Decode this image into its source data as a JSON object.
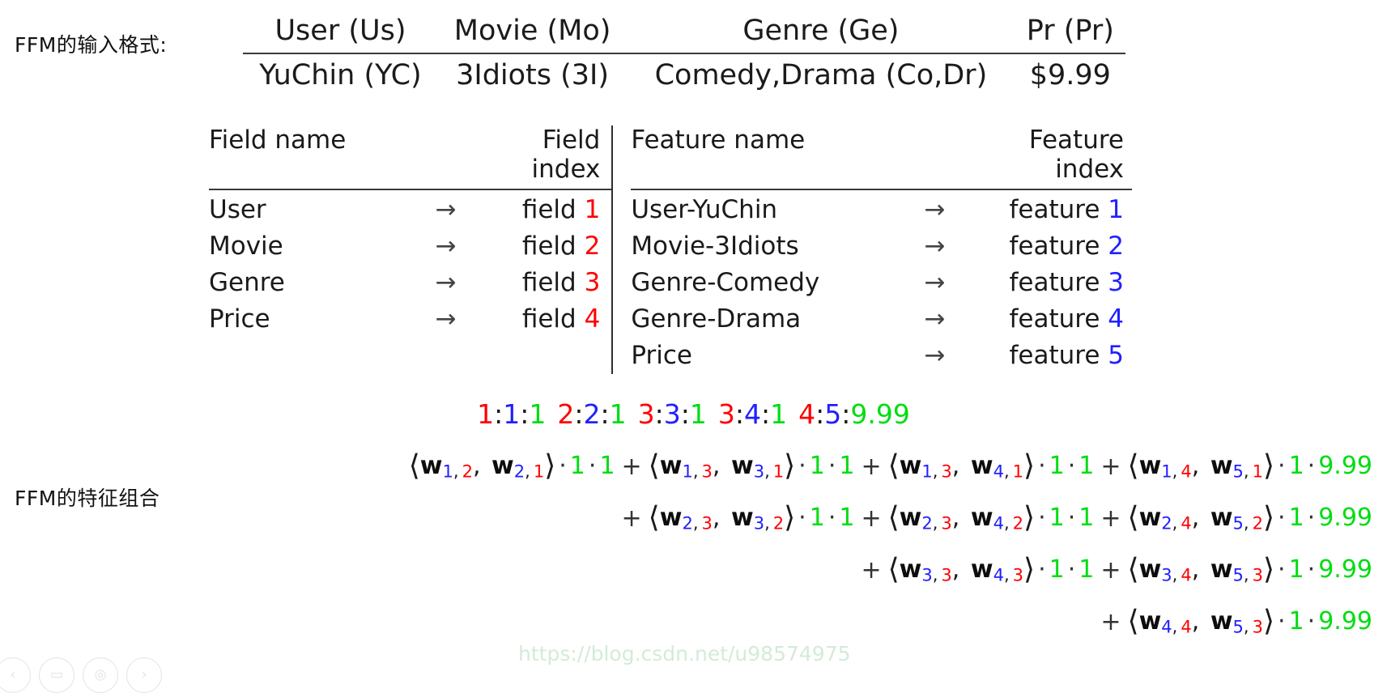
{
  "labels": {
    "input_format": "FFM的输入格式:",
    "feature_combination": "FFM的特征组合"
  },
  "input_format_table": {
    "headers": [
      "User (Us)",
      "Movie (Mo)",
      "Genre (Ge)",
      "Pr (Pr)"
    ],
    "row": [
      "YuChin (YC)",
      "3Idiots (3I)",
      "Comedy,Drama (Co,Dr)",
      "$9.99"
    ]
  },
  "mapping": {
    "field": {
      "header_name": "Field name",
      "header_index": "Field index",
      "arrow": "→",
      "index_prefix": "field",
      "rows": [
        {
          "name": "User",
          "index": "1"
        },
        {
          "name": "Movie",
          "index": "2"
        },
        {
          "name": "Genre",
          "index": "3"
        },
        {
          "name": "Price",
          "index": "4"
        }
      ]
    },
    "feature": {
      "header_name": "Feature name",
      "header_index": "Feature index",
      "arrow": "→",
      "index_prefix": "feature",
      "rows": [
        {
          "name": "User-YuChin",
          "index": "1"
        },
        {
          "name": "Movie-3Idiots",
          "index": "2"
        },
        {
          "name": "Genre-Comedy",
          "index": "3"
        },
        {
          "name": "Genre-Drama",
          "index": "4"
        },
        {
          "name": "Price",
          "index": "5"
        }
      ]
    }
  },
  "libffm_line": {
    "separator": ":",
    "tokens": [
      {
        "field": "1",
        "feature": "1",
        "value": "1"
      },
      {
        "field": "2",
        "feature": "2",
        "value": "1"
      },
      {
        "field": "3",
        "feature": "3",
        "value": "1"
      },
      {
        "field": "3",
        "feature": "4",
        "value": "1"
      },
      {
        "field": "4",
        "feature": "5",
        "value": "9.99"
      }
    ]
  },
  "formula": {
    "open": "⟨",
    "close": "⟩",
    "w": "w",
    "comma": ",",
    "dot": "·",
    "plus": "+",
    "lines": [
      {
        "leading_plus": false,
        "terms": [
          {
            "a_feat": "1",
            "a_field": "2",
            "b_feat": "2",
            "b_field": "1",
            "v1": "1",
            "v2": "1"
          },
          {
            "a_feat": "1",
            "a_field": "3",
            "b_feat": "3",
            "b_field": "1",
            "v1": "1",
            "v2": "1"
          },
          {
            "a_feat": "1",
            "a_field": "3",
            "b_feat": "4",
            "b_field": "1",
            "v1": "1",
            "v2": "1"
          },
          {
            "a_feat": "1",
            "a_field": "4",
            "b_feat": "5",
            "b_field": "1",
            "v1": "1",
            "v2": "9.99"
          }
        ]
      },
      {
        "leading_plus": true,
        "terms": [
          {
            "a_feat": "2",
            "a_field": "3",
            "b_feat": "3",
            "b_field": "2",
            "v1": "1",
            "v2": "1"
          },
          {
            "a_feat": "2",
            "a_field": "3",
            "b_feat": "4",
            "b_field": "2",
            "v1": "1",
            "v2": "1"
          },
          {
            "a_feat": "2",
            "a_field": "4",
            "b_feat": "5",
            "b_field": "2",
            "v1": "1",
            "v2": "9.99"
          }
        ]
      },
      {
        "leading_plus": true,
        "terms": [
          {
            "a_feat": "3",
            "a_field": "3",
            "b_feat": "4",
            "b_field": "3",
            "v1": "1",
            "v2": "1"
          },
          {
            "a_feat": "3",
            "a_field": "4",
            "b_feat": "5",
            "b_field": "3",
            "v1": "1",
            "v2": "9.99"
          }
        ]
      },
      {
        "leading_plus": true,
        "terms": [
          {
            "a_feat": "4",
            "a_field": "4",
            "b_feat": "5",
            "b_field": "3",
            "v1": "1",
            "v2": "9.99"
          }
        ]
      }
    ]
  },
  "watermark": "https://blog.csdn.net/u98574975",
  "nav_icons": [
    {
      "name": "prev-slide-icon",
      "glyph": "‹"
    },
    {
      "name": "slides-overview-icon",
      "glyph": "▭"
    },
    {
      "name": "target-icon",
      "glyph": "◎"
    },
    {
      "name": "next-slide-icon",
      "glyph": "›"
    }
  ],
  "colors": {
    "field_index": "#ff0000",
    "feature_index": "#2020ff",
    "value": "#00dd11",
    "text": "#1b1b1b"
  }
}
